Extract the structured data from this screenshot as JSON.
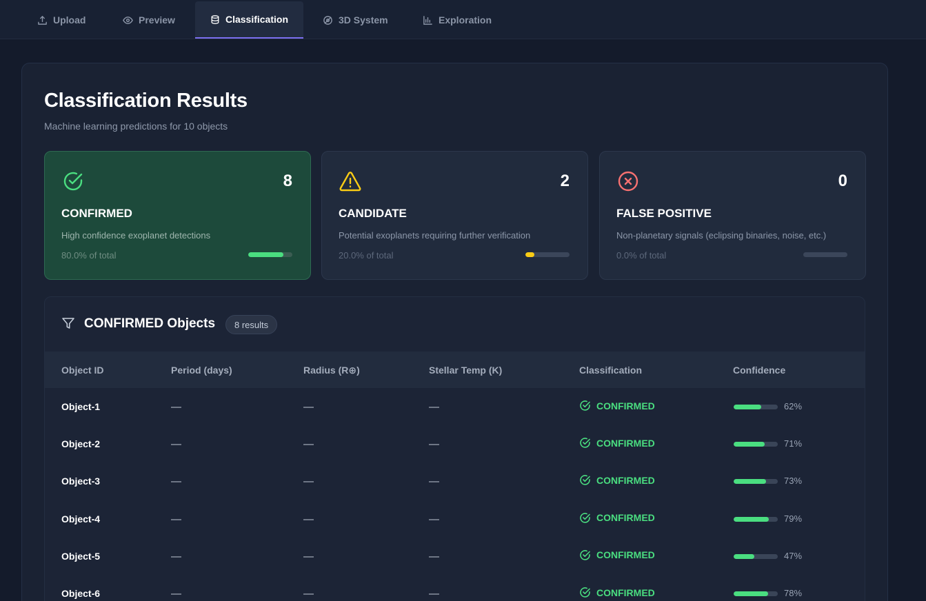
{
  "tabs": [
    {
      "label": "Upload",
      "icon": "upload-icon"
    },
    {
      "label": "Preview",
      "icon": "eye-icon"
    },
    {
      "label": "Classification",
      "icon": "database-icon",
      "active": true
    },
    {
      "label": "3D System",
      "icon": "orbit-icon"
    },
    {
      "label": "Exploration",
      "icon": "bar-chart-icon"
    }
  ],
  "header": {
    "title": "Classification Results",
    "subtitle": "Machine learning predictions for 10 objects"
  },
  "cards": [
    {
      "count": "8",
      "title": "CONFIRMED",
      "desc": "High confidence exoplanet detections",
      "pct_label": "80.0% of total",
      "fraction": 0.8,
      "icon": "check-circle-icon",
      "color": "#4ade80"
    },
    {
      "count": "2",
      "title": "CANDIDATE",
      "desc": "Potential exoplanets requiring further verification",
      "pct_label": "20.0% of total",
      "fraction": 0.2,
      "icon": "warning-triangle-icon",
      "color": "#facc15"
    },
    {
      "count": "0",
      "title": "FALSE POSITIVE",
      "desc": "Non-planetary signals (eclipsing binaries, noise, etc.)",
      "pct_label": "0.0% of total",
      "fraction": 0.0,
      "icon": "x-circle-icon",
      "color": "#f87171"
    }
  ],
  "objects": {
    "title": "CONFIRMED Objects",
    "badge": "8 results",
    "columns": [
      "Object ID",
      "Period (days)",
      "Radius (R⊕)",
      "Stellar Temp (K)",
      "Classification",
      "Confidence"
    ],
    "rows": [
      {
        "id": "Object-1",
        "period": "—",
        "radius": "—",
        "temp": "—",
        "classification": "CONFIRMED",
        "confidence": 0.62,
        "confidence_label": "62%"
      },
      {
        "id": "Object-2",
        "period": "—",
        "radius": "—",
        "temp": "—",
        "classification": "CONFIRMED",
        "confidence": 0.71,
        "confidence_label": "71%"
      },
      {
        "id": "Object-3",
        "period": "—",
        "radius": "—",
        "temp": "—",
        "classification": "CONFIRMED",
        "confidence": 0.73,
        "confidence_label": "73%"
      },
      {
        "id": "Object-4",
        "period": "—",
        "radius": "—",
        "temp": "—",
        "classification": "CONFIRMED",
        "confidence": 0.79,
        "confidence_label": "79%"
      },
      {
        "id": "Object-5",
        "period": "—",
        "radius": "—",
        "temp": "—",
        "classification": "CONFIRMED",
        "confidence": 0.47,
        "confidence_label": "47%"
      },
      {
        "id": "Object-6",
        "period": "—",
        "radius": "—",
        "temp": "—",
        "classification": "CONFIRMED",
        "confidence": 0.78,
        "confidence_label": "78%"
      }
    ]
  },
  "colors": {
    "accent": "#7c6ff0",
    "confirmed": "#4ade80",
    "candidate": "#facc15",
    "false_positive": "#f87171"
  }
}
